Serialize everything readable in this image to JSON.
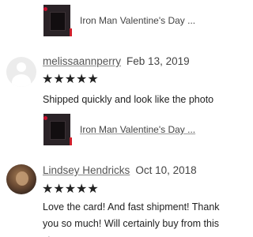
{
  "top_product": {
    "title": "Iron Man Valentine's Day ..."
  },
  "reviews": [
    {
      "reviewer": "melissaannperry",
      "date": "Feb 13, 2019",
      "stars": "★★★★★",
      "rating": 5,
      "text": "Shipped quickly and look like the photo",
      "product_title": "Iron Man Valentine's Day ..."
    },
    {
      "reviewer": "Lindsey Hendricks",
      "date": "Oct 10, 2018",
      "stars": "★★★★★",
      "rating": 5,
      "text": "Love the card! And fast shipment! Thank you so much! Will certainly buy from this store"
    }
  ]
}
